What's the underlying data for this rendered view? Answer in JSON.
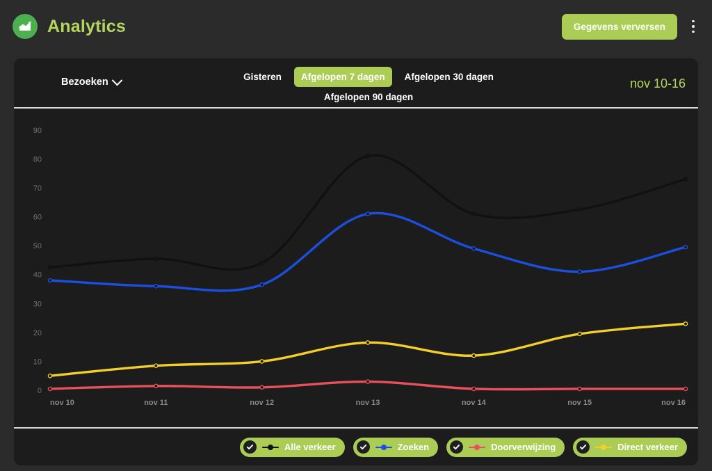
{
  "header": {
    "logo_icon": "chart-line-up-icon",
    "title": "Analytics",
    "refresh_label": "Gegevens verversen",
    "menu_icon": "kebab-menu-icon",
    "brand_color": "#b5d65c",
    "accent_color": "#abcd56",
    "logo_bg": "#4caf50"
  },
  "toolbar": {
    "metric_label": "Bezoeken",
    "metric_chevron": "chevron-down-icon",
    "ranges": [
      {
        "label": "Gisteren",
        "active": false
      },
      {
        "label": "Afgelopen 7 dagen",
        "active": true
      },
      {
        "label": "Afgelopen 30 dagen",
        "active": false
      },
      {
        "label": "Afgelopen 90 dagen",
        "active": false
      }
    ],
    "date_range": "nov 10-16"
  },
  "legend": [
    {
      "label": "Alle verkeer",
      "color": "#111111",
      "checked": true
    },
    {
      "label": "Zoeken",
      "color": "#1a4fe0",
      "checked": true
    },
    {
      "label": "Doorverwijzing",
      "color": "#e8505b",
      "checked": true
    },
    {
      "label": "Direct verkeer",
      "color": "#f2cf2a",
      "checked": true
    }
  ],
  "chart_data": {
    "type": "line",
    "title": "",
    "xlabel": "",
    "ylabel": "",
    "categories": [
      "nov 10",
      "nov 11",
      "nov 12",
      "nov 13",
      "nov 14",
      "nov 15",
      "nov 16"
    ],
    "ylim": [
      0,
      95
    ],
    "yticks": [
      0,
      10,
      20,
      30,
      40,
      50,
      60,
      70,
      80,
      90
    ],
    "grid": false,
    "legend_position": "bottom-right",
    "smoothing": "monotone-spline",
    "series": [
      {
        "name": "Alle verkeer",
        "color": "#111111",
        "values": [
          42.5,
          45.5,
          44,
          81,
          61,
          62.5,
          73
        ]
      },
      {
        "name": "Zoeken",
        "color": "#1a4fe0",
        "values": [
          38,
          36,
          36.5,
          61,
          49,
          41,
          49.5
        ]
      },
      {
        "name": "Doorverwijzing",
        "color": "#e8505b",
        "values": [
          0.5,
          1.5,
          1,
          3,
          0.5,
          0.5,
          0.5
        ]
      },
      {
        "name": "Direct verkeer",
        "color": "#f2cf2a",
        "values": [
          5,
          8.5,
          10,
          16.5,
          12,
          19.5,
          23
        ]
      }
    ]
  }
}
